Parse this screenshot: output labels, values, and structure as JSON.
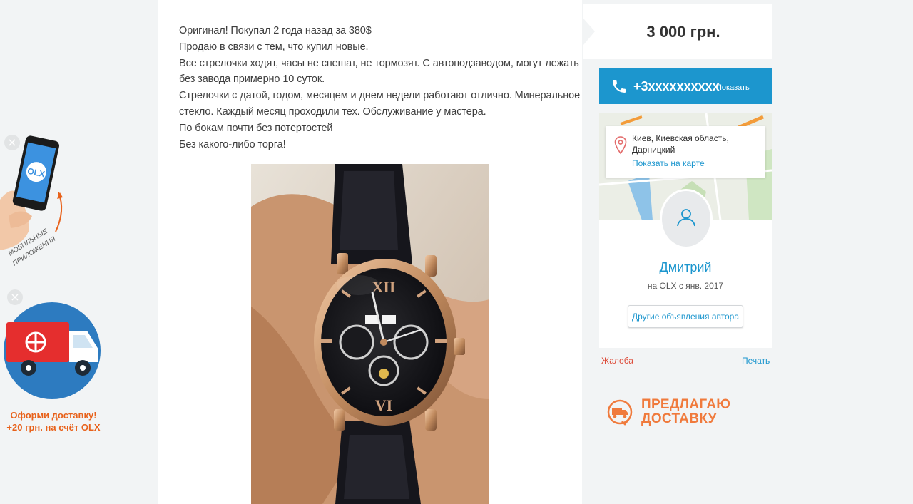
{
  "promos": {
    "apps": {
      "close_glyph": "×",
      "logo_text": "OLX",
      "caption_line1": "МОБИЛЬНЫЕ",
      "caption_line2": "ПРИЛОЖЕНИЯ"
    },
    "delivery": {
      "close_glyph": "×",
      "line1": "Оформи доставку!",
      "line2": "+20 грн. на счёт OLX"
    }
  },
  "description": {
    "lines": [
      "Оригинал! Покупал 2 года назад за 380$",
      "Продаю в связи с тем, что купил новые.",
      "Все стрелочки ходят, часы не спешат, не тормозят. С автоподзаводом, могут лежать",
      "без завода примерно 10 суток.",
      "Стрелочки с датой, годом, месяцем и днем недели работают отлично. Минеральное",
      "стекло. Каждый месяц проходили тех. Обслуживание у мастера.",
      "По бокам почти без потертостей",
      "Без какого-либо торга!"
    ]
  },
  "sidebar": {
    "price": "3 000 грн.",
    "phone": {
      "number": "+3xxxxxxxxxx",
      "show_label": "Показать"
    },
    "location": {
      "line1": "Киев, Киевская область,",
      "line2": "Дарницкий",
      "map_link": "Показать на карте"
    },
    "seller": {
      "name": "Дмитрий",
      "since": "на OLX с янв. 2017",
      "other_ads_label": "Другие объявления автора"
    },
    "complaint_label": "Жалоба",
    "print_label": "Печать",
    "delivery_badge": {
      "line1": "ПРЕДЛАГАЮ",
      "line2": "ДОСТАВКУ"
    }
  },
  "colors": {
    "accent_blue": "#1c96ce",
    "delivery_orange": "#f07a3c",
    "complaint_red": "#dd4b39",
    "page_bg": "#f2f4f5"
  }
}
